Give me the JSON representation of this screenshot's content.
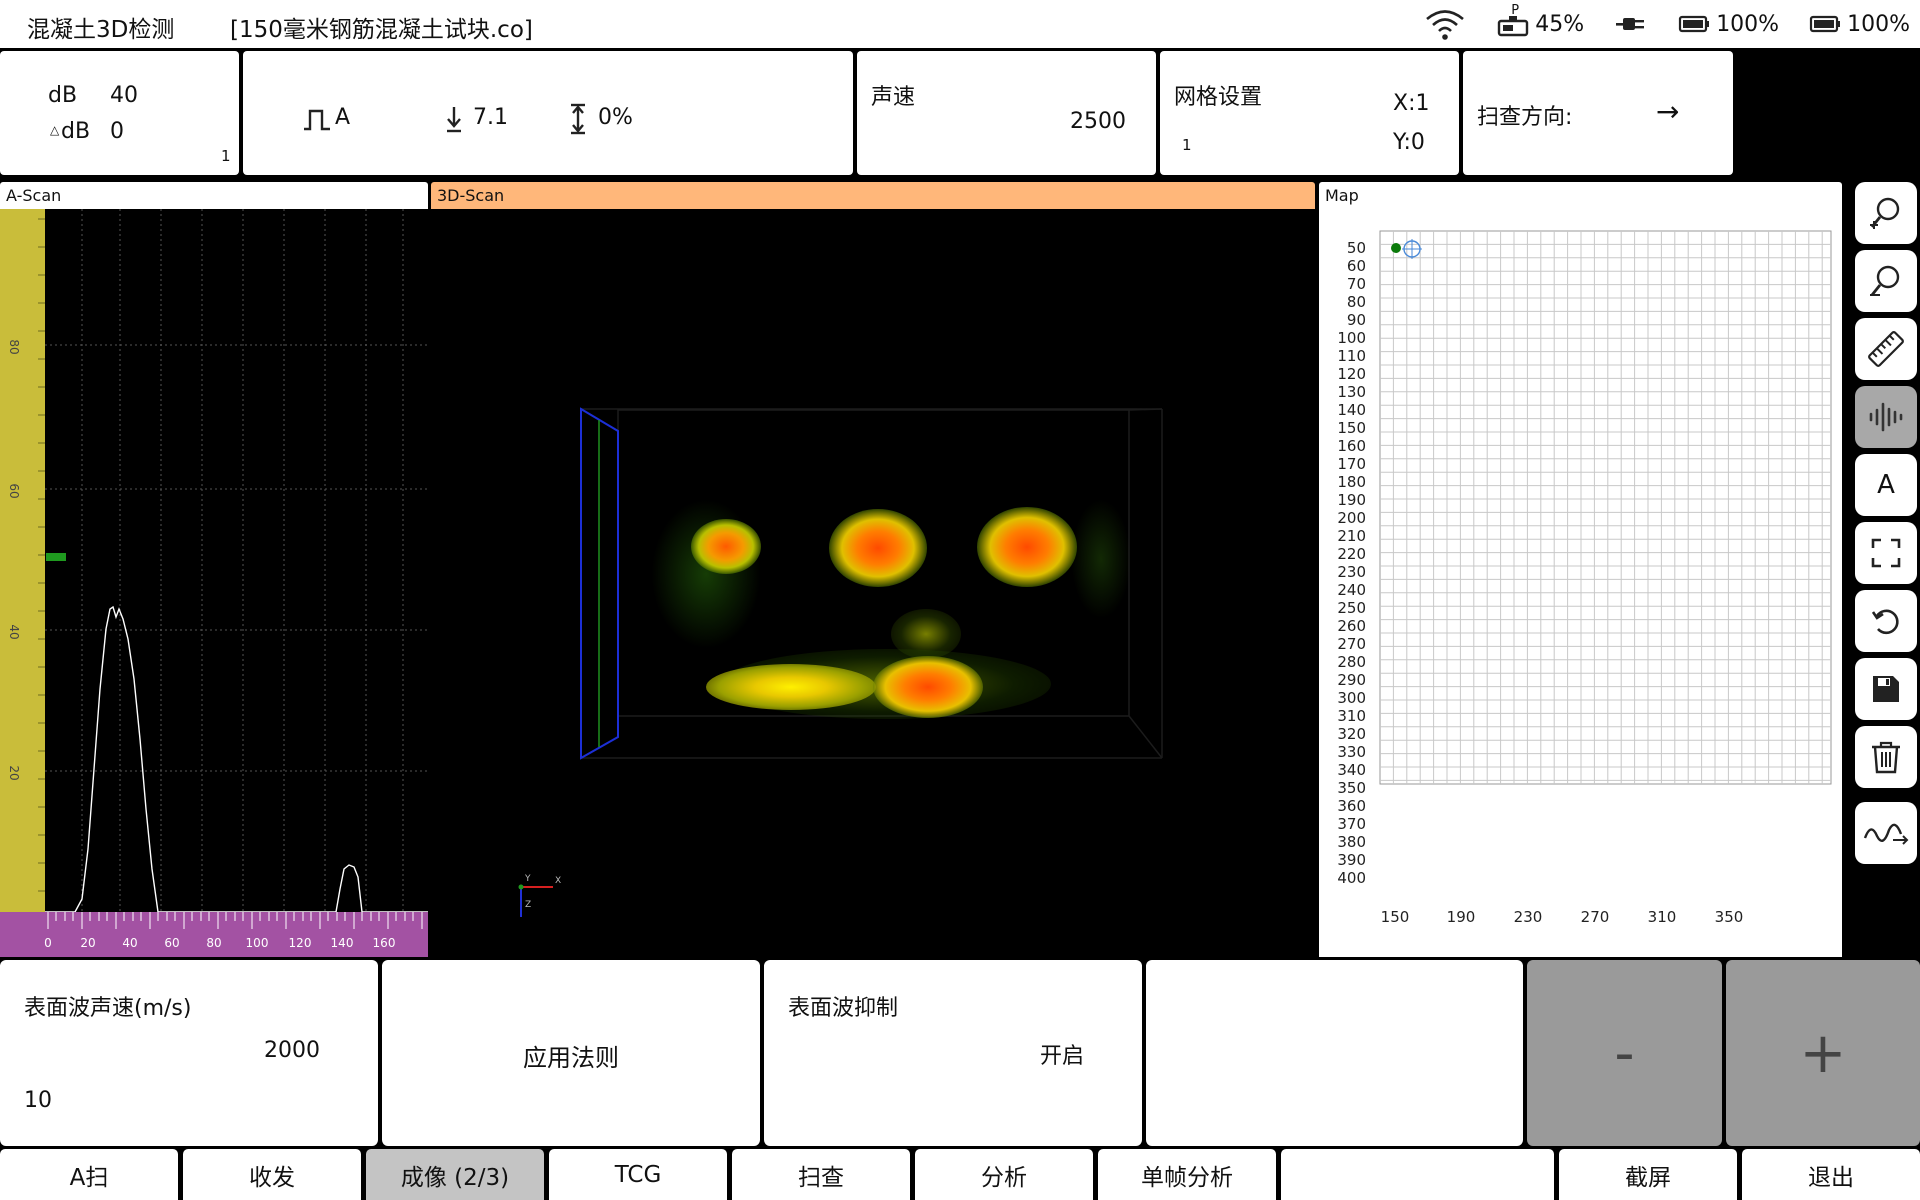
{
  "status": {
    "app_title": "混凝土3D检测",
    "file_name": "[150毫米钢筋混凝土试块.co]",
    "battery_probe": "45%",
    "probe_label": "P",
    "battery_1": "100%",
    "battery_2": "100%"
  },
  "params": {
    "db_label": "dB",
    "db_value": "40",
    "delta_db_label": "dB",
    "delta_db_value": "0",
    "db_step": "1",
    "gate_mode": "A",
    "gate_start": "7.1",
    "gate_width": "0%",
    "velocity_label": "声速",
    "velocity_value": "2500",
    "grid_label": "网格设置",
    "grid_step": "1",
    "grid_x": "X:1",
    "grid_y": "Y:0",
    "scan_dir_label": "扫查方向:",
    "scan_dir_value": "→"
  },
  "views": {
    "ascan_title": "A-Scan",
    "scan3d_title": "3D-Scan",
    "map_title": "Map"
  },
  "ascan": {
    "y_ticks": [
      "80",
      "60",
      "40",
      "20"
    ],
    "x_ticks": [
      "0",
      "20",
      "40",
      "60",
      "80",
      "100",
      "120",
      "140",
      "160"
    ]
  },
  "axis3d": {
    "y": "Y",
    "x": "X",
    "z": "Z"
  },
  "map": {
    "y_ticks": [
      "50",
      "60",
      "70",
      "80",
      "90",
      "100",
      "110",
      "120",
      "130",
      "140",
      "150",
      "160",
      "170",
      "180",
      "190",
      "200",
      "210",
      "220",
      "230",
      "240",
      "250",
      "260",
      "270",
      "280",
      "290",
      "300",
      "310",
      "320",
      "330",
      "340",
      "350",
      "360",
      "370",
      "380",
      "390",
      "400"
    ],
    "x_ticks": [
      "150",
      "190",
      "230",
      "270",
      "310",
      "350"
    ]
  },
  "controls": {
    "surface_velocity_label": "表面波声速(m/s)",
    "surface_velocity_value": "2000",
    "surface_velocity_step": "10",
    "apply_rule": "应用法则",
    "surface_suppress_label": "表面波抑制",
    "surface_suppress_value": "开启",
    "minus": "-",
    "plus": "+"
  },
  "tabs": [
    "A扫",
    "收发",
    "成像 (2/3)",
    "TCG",
    "扫查",
    "分析",
    "单帧分析",
    "",
    "截屏",
    "退出"
  ],
  "colors": {
    "accent_3d": "#ffb77a",
    "ascan_level": "#c9bd3a",
    "ascan_ruler": "#a352a3",
    "tool_active": "#a8a8a8"
  }
}
